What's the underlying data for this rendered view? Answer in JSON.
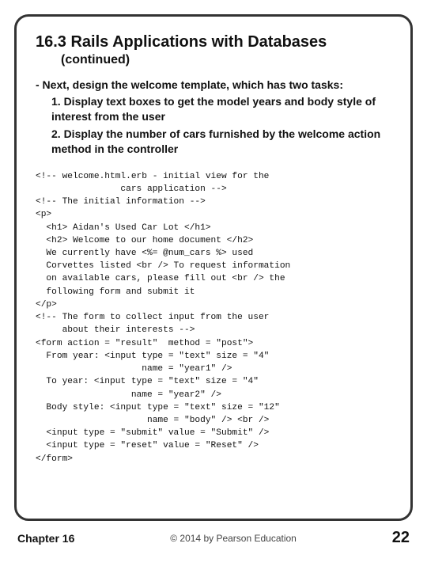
{
  "slide": {
    "title": "16.3 Rails Applications with Databases",
    "subtitle": "(continued)",
    "bullet_main": "- Next, design the welcome template, which has two tasks:",
    "bullets": [
      "1. Display text boxes to get the model years and body style of interest from the user",
      "2. Display the number of cars furnished by the welcome action method in the controller"
    ],
    "code": "<!-- welcome.html.erb - initial view for the\n                cars application -->\n<!-- The initial information -->\n<p>\n  <h1> Aidan's Used Car Lot </h1>\n  <h2> Welcome to our home document </h2>\n  We currently have <%= @num_cars %> used\n  Corvettes listed <br /> To request information\n  on available cars, please fill out <br /> the\n  following form and submit it\n</p>\n<!-- The form to collect input from the user\n     about their interests -->\n<form action = \"result\"  method = \"post\">\n  From year: <input type = \"text\" size = \"4\"\n                    name = \"year1\" />\n  To year: <input type = \"text\" size = \"4\"\n                  name = \"year2\" />\n  Body style: <input type = \"text\" size = \"12\"\n                     name = \"body\" /> <br />\n  <input type = \"submit\" value = \"Submit\" />\n  <input type = \"reset\" value = \"Reset\" />\n</form>"
  },
  "footer": {
    "chapter": "Chapter 16",
    "copyright": "© 2014 by Pearson Education",
    "page": "22"
  }
}
